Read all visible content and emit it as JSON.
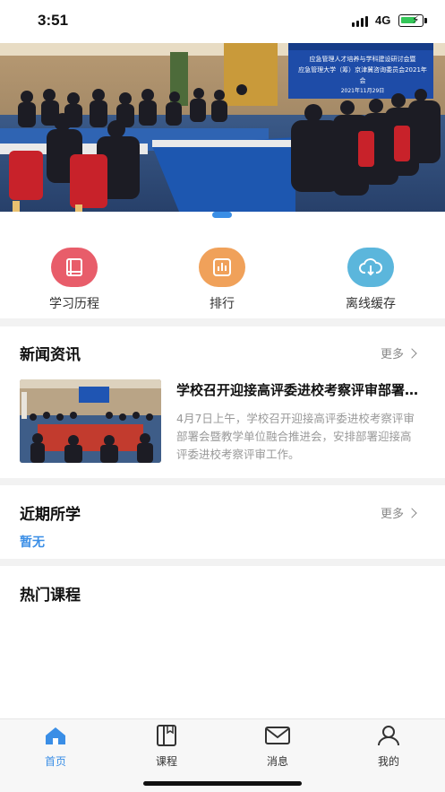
{
  "status_bar": {
    "time": "3:51",
    "network": "4G"
  },
  "banner": {
    "screen_line1": "应急管理人才培养与学科建设研讨会暨",
    "screen_line2": "应急管理大学（筹）京津冀咨询委员会2021年会",
    "screen_date": "2021年11月29日"
  },
  "quick_actions": [
    {
      "label": "学习历程",
      "icon": "book-icon",
      "color": "#e85d6a"
    },
    {
      "label": "排行",
      "icon": "chart-icon",
      "color": "#f0a15a"
    },
    {
      "label": "离线缓存",
      "icon": "cloud-download-icon",
      "color": "#5bb6dc"
    }
  ],
  "news_section": {
    "title": "新闻资讯",
    "more_label": "更多",
    "item": {
      "title": "学校召开迎接高评委进校考察评审部署会暨教学单位融合推进会",
      "summary": "4月7日上午，学校召开迎接高评委进校考察评审部署会暨教学单位融合推进会，安排部署迎接高评委进校考察评审工作。"
    }
  },
  "recent_section": {
    "title": "近期所学",
    "more_label": "更多",
    "empty_text": "暂无"
  },
  "hot_section": {
    "title": "热门课程"
  },
  "tabbar": [
    {
      "label": "首页",
      "icon": "home-icon",
      "active": true
    },
    {
      "label": "课程",
      "icon": "course-icon",
      "active": false
    },
    {
      "label": "消息",
      "icon": "mail-icon",
      "active": false
    },
    {
      "label": "我的",
      "icon": "user-icon",
      "active": false
    }
  ],
  "colors": {
    "accent": "#3a8ee6",
    "divider": "#f2f2f2"
  }
}
